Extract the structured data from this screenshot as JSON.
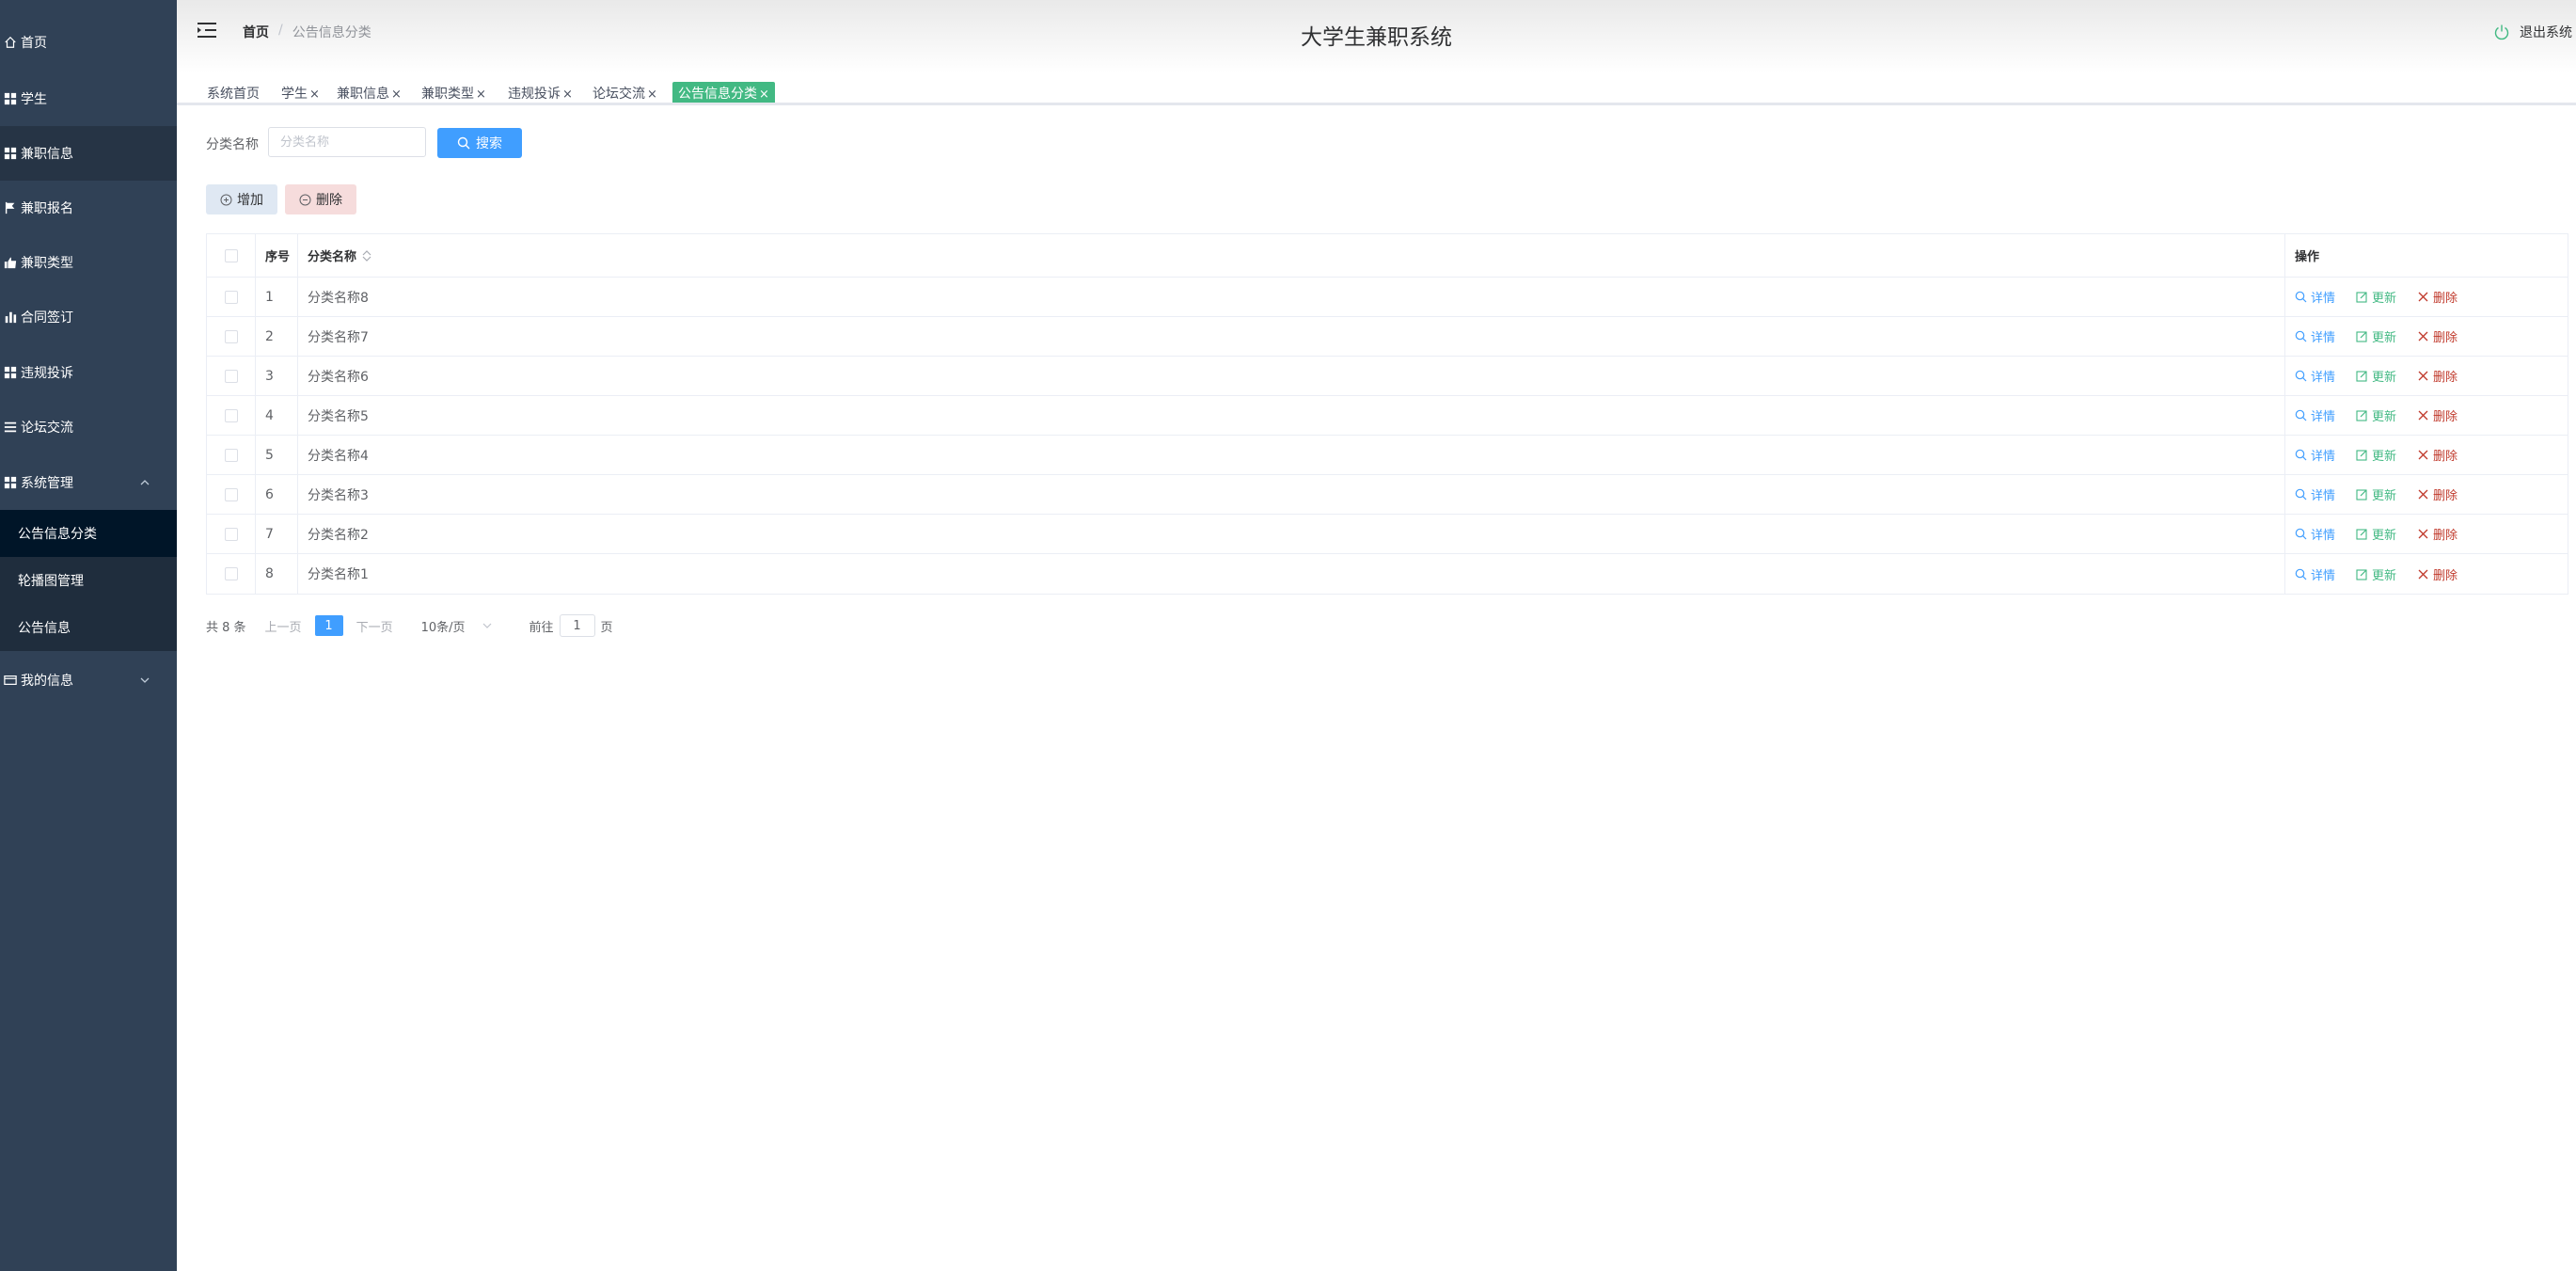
{
  "app": {
    "title": "大学生兼职系统",
    "logout_label": "退出系统"
  },
  "breadcrumb": {
    "home": "首页",
    "separator": "/",
    "current": "公告信息分类"
  },
  "sidebar": {
    "items": [
      {
        "label": "首页",
        "icon": "home-icon"
      },
      {
        "label": "学生",
        "icon": "grid-icon"
      },
      {
        "label": "兼职信息",
        "icon": "grid-icon"
      },
      {
        "label": "兼职报名",
        "icon": "flag-icon"
      },
      {
        "label": "兼职类型",
        "icon": "thumb-icon"
      },
      {
        "label": "合同签订",
        "icon": "bar-chart-icon"
      },
      {
        "label": "违规投诉",
        "icon": "grid-icon"
      },
      {
        "label": "论坛交流",
        "icon": "list-icon"
      },
      {
        "label": "系统管理",
        "icon": "grid-icon",
        "expanded": true
      },
      {
        "label": "我的信息",
        "icon": "card-icon",
        "expanded": false
      }
    ],
    "system_sub": [
      {
        "label": "公告信息分类",
        "selected": true
      },
      {
        "label": "轮播图管理"
      },
      {
        "label": "公告信息"
      }
    ]
  },
  "tags": [
    {
      "label": "系统首页",
      "closable": false
    },
    {
      "label": "学生",
      "closable": true
    },
    {
      "label": "兼职信息",
      "closable": true
    },
    {
      "label": "兼职类型",
      "closable": true
    },
    {
      "label": "违规投诉",
      "closable": true
    },
    {
      "label": "论坛交流",
      "closable": true
    },
    {
      "label": "公告信息分类",
      "closable": true,
      "active": true
    }
  ],
  "tag_close": "×",
  "search": {
    "label": "分类名称",
    "placeholder": "分类名称",
    "button": "搜索"
  },
  "actions": {
    "add": "增加",
    "delete": "删除"
  },
  "table": {
    "columns": {
      "index": "序号",
      "name": "分类名称",
      "ops": "操作"
    },
    "rows": [
      {
        "index": "1",
        "name": "分类名称8"
      },
      {
        "index": "2",
        "name": "分类名称7"
      },
      {
        "index": "3",
        "name": "分类名称6"
      },
      {
        "index": "4",
        "name": "分类名称5"
      },
      {
        "index": "5",
        "name": "分类名称4"
      },
      {
        "index": "6",
        "name": "分类名称3"
      },
      {
        "index": "7",
        "name": "分类名称2"
      },
      {
        "index": "8",
        "name": "分类名称1"
      }
    ],
    "row_ops": {
      "detail": "详情",
      "update": "更新",
      "delete": "删除"
    }
  },
  "pagination": {
    "total": "共 8 条",
    "prev": "上一页",
    "page": "1",
    "next": "下一页",
    "size": "10条/页",
    "goto_label": "前往",
    "goto_value": "1",
    "goto_suffix": "页"
  },
  "colors": {
    "sidebar": "#304156",
    "primary": "#409eff",
    "success": "#42b983",
    "danger": "#c0392b"
  }
}
